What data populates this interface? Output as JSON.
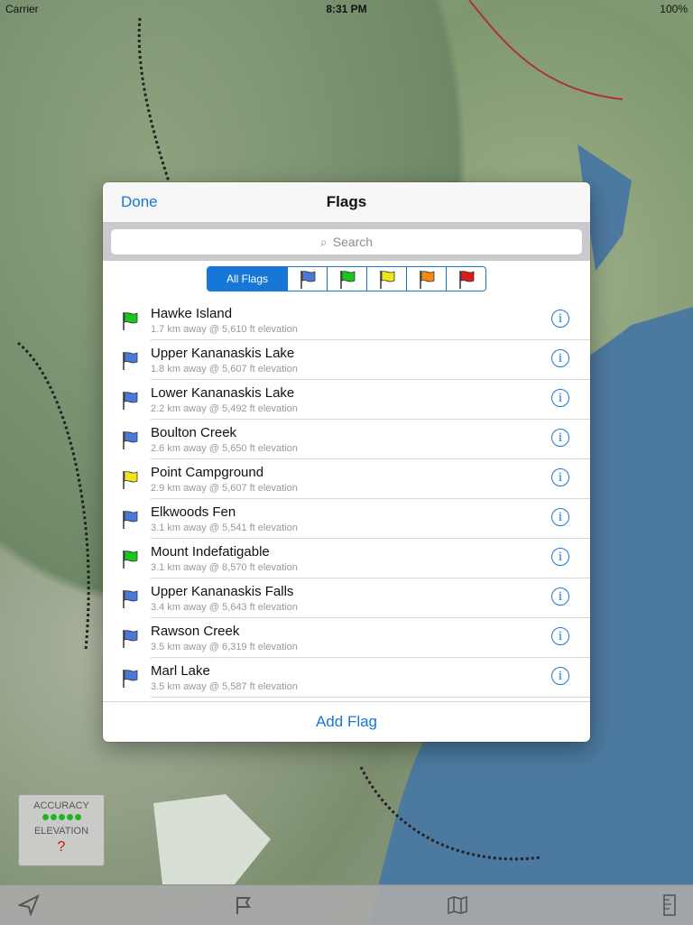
{
  "status": {
    "carrier": "Carrier",
    "time": "8:31 PM",
    "battery": "100%"
  },
  "modal": {
    "title": "Flags",
    "done_label": "Done",
    "add_label": "Add Flag"
  },
  "search": {
    "placeholder": "Search"
  },
  "filters": {
    "all_label": "All Flags",
    "flag_colors": [
      "#4a78d4",
      "#19c61d",
      "#f0e51c",
      "#f28a15",
      "#e2191a"
    ]
  },
  "flags": [
    {
      "name": "Hawke Island",
      "detail": "1.7 km away @ 5,610 ft elevation",
      "color": "#19c61d"
    },
    {
      "name": "Upper Kananaskis Lake",
      "detail": "1.8 km away @ 5,607 ft elevation",
      "color": "#4a78d4"
    },
    {
      "name": "Lower Kananaskis Lake",
      "detail": "2.2 km away @ 5,492 ft elevation",
      "color": "#4a78d4"
    },
    {
      "name": "Boulton Creek",
      "detail": "2.6 km away @ 5,650 ft elevation",
      "color": "#4a78d4"
    },
    {
      "name": "Point Campground",
      "detail": "2.9 km away @ 5,607 ft elevation",
      "color": "#f0e51c"
    },
    {
      "name": "Elkwoods Fen",
      "detail": "3.1 km away @ 5,541 ft elevation",
      "color": "#4a78d4"
    },
    {
      "name": "Mount Indefatigable",
      "detail": "3.1 km away @ 8,570 ft elevation",
      "color": "#19c61d"
    },
    {
      "name": "Upper Kananaskis Falls",
      "detail": "3.4 km away @ 5,643 ft elevation",
      "color": "#4a78d4"
    },
    {
      "name": "Rawson Creek",
      "detail": "3.5 km away @ 6,319 ft elevation",
      "color": "#4a78d4"
    },
    {
      "name": "Marl Lake",
      "detail": "3.5 km away @ 5,587 ft elevation",
      "color": "#4a78d4"
    }
  ],
  "accuracy": {
    "label": "ACCURACY",
    "elevation_label": "ELEVATION",
    "unknown": "?"
  },
  "tabbar": {
    "icons": [
      "location-arrow-icon",
      "flag-outline-icon",
      "map-icon",
      "ruler-icon"
    ]
  }
}
